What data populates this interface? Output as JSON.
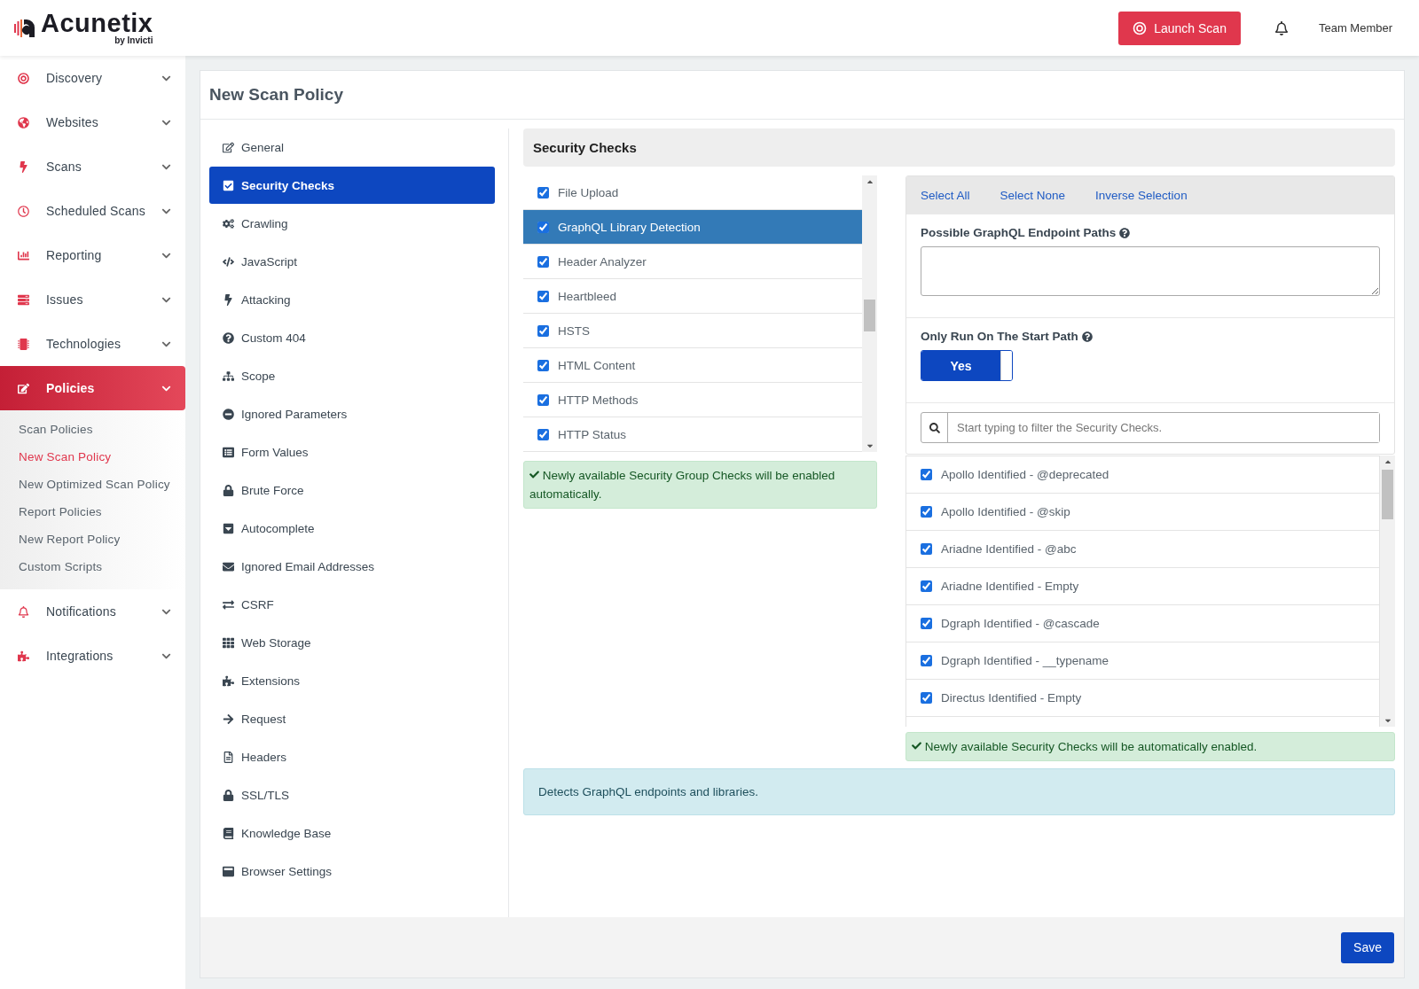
{
  "header": {
    "logo": "Acunetix",
    "logo_sub": "by Invicti",
    "launch_button": "Launch Scan",
    "user": "Team Member"
  },
  "sidebar": {
    "items": [
      {
        "label": "Discovery",
        "selected": false
      },
      {
        "label": "Websites",
        "selected": false
      },
      {
        "label": "Scans",
        "selected": false
      },
      {
        "label": "Scheduled Scans",
        "selected": false
      },
      {
        "label": "Reporting",
        "selected": false
      },
      {
        "label": "Issues",
        "selected": false
      },
      {
        "label": "Technologies",
        "selected": false
      },
      {
        "label": "Policies",
        "selected": true,
        "children": [
          {
            "label": "Scan Policies",
            "selected": false
          },
          {
            "label": "New Scan Policy",
            "selected": true
          },
          {
            "label": "New Optimized Scan Policy",
            "selected": false
          },
          {
            "label": "Report Policies",
            "selected": false
          },
          {
            "label": "New Report Policy",
            "selected": false
          },
          {
            "label": "Custom Scripts",
            "selected": false
          }
        ]
      },
      {
        "label": "Notifications",
        "selected": false
      },
      {
        "label": "Integrations",
        "selected": false
      }
    ]
  },
  "page": {
    "title": "New Scan Policy",
    "sections": [
      {
        "label": "General",
        "selected": false
      },
      {
        "label": "Security Checks",
        "selected": true
      },
      {
        "label": "Crawling",
        "selected": false
      },
      {
        "label": "JavaScript",
        "selected": false
      },
      {
        "label": "Attacking",
        "selected": false
      },
      {
        "label": "Custom 404",
        "selected": false
      },
      {
        "label": "Scope",
        "selected": false
      },
      {
        "label": "Ignored Parameters",
        "selected": false
      },
      {
        "label": "Form Values",
        "selected": false
      },
      {
        "label": "Brute Force",
        "selected": false
      },
      {
        "label": "Autocomplete",
        "selected": false
      },
      {
        "label": "Ignored Email Addresses",
        "selected": false
      },
      {
        "label": "CSRF",
        "selected": false
      },
      {
        "label": "Web Storage",
        "selected": false
      },
      {
        "label": "Extensions",
        "selected": false
      },
      {
        "label": "Request",
        "selected": false
      },
      {
        "label": "Headers",
        "selected": false
      },
      {
        "label": "SSL/TLS",
        "selected": false
      },
      {
        "label": "Knowledge Base",
        "selected": false
      },
      {
        "label": "Browser Settings",
        "selected": false
      }
    ],
    "panel_title": "Security Checks",
    "groups": [
      {
        "label": "File Upload",
        "checked": true,
        "selected": false
      },
      {
        "label": "GraphQL Library Detection",
        "checked": true,
        "selected": true
      },
      {
        "label": "Header Analyzer",
        "checked": true,
        "selected": false
      },
      {
        "label": "Heartbleed",
        "checked": true,
        "selected": false
      },
      {
        "label": "HSTS",
        "checked": true,
        "selected": false
      },
      {
        "label": "HTML Content",
        "checked": true,
        "selected": false
      },
      {
        "label": "HTTP Methods",
        "checked": true,
        "selected": false
      },
      {
        "label": "HTTP Status",
        "checked": true,
        "selected": false
      }
    ],
    "group_note": "Newly available Security Group Checks will be enabled automatically.",
    "selection_links": [
      "Select All",
      "Select None",
      "Inverse Selection"
    ],
    "endpoint_paths": {
      "label": "Possible GraphQL Endpoint Paths"
    },
    "start_path": {
      "label": "Only Run On The Start Path",
      "on": true,
      "text": "Yes"
    },
    "filter": {
      "placeholder": "Start typing to filter the Security Checks."
    },
    "checks": [
      {
        "label": "Apollo Identified - @deprecated",
        "checked": true
      },
      {
        "label": "Apollo Identified - @skip",
        "checked": true
      },
      {
        "label": "Ariadne Identified - @abc",
        "checked": true
      },
      {
        "label": "Ariadne Identified - Empty",
        "checked": true
      },
      {
        "label": "Dgraph Identified - @cascade",
        "checked": true
      },
      {
        "label": "Dgraph Identified - __typename",
        "checked": true
      },
      {
        "label": "Directus Identified - Empty",
        "checked": true
      }
    ],
    "checks_note": "Newly available Security Checks will be automatically enabled.",
    "description": "Detects GraphQL endpoints and libraries.",
    "save_button": "Save"
  }
}
